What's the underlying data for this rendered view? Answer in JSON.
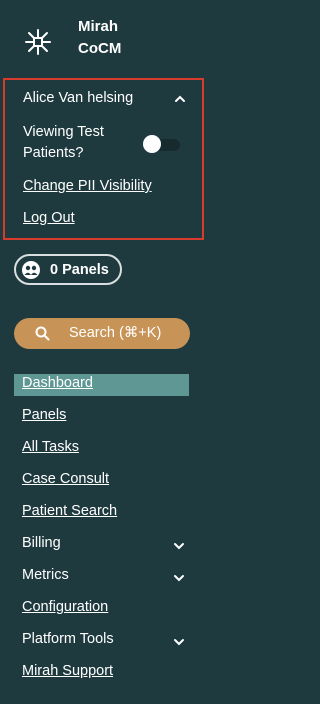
{
  "brand": {
    "line1": "Mirah",
    "line2": "CoCM"
  },
  "user_menu": {
    "name": "Alice Van helsing",
    "viewing_label": "Viewing Test Patients?",
    "toggle_on": false,
    "change_pii_label": "Change PII Visibility",
    "logout_label": "Log Out"
  },
  "panels": {
    "label": "0 Panels"
  },
  "search": {
    "label": "Search  (⌘+K)"
  },
  "nav": {
    "items": [
      {
        "label": "Dashboard",
        "active": true,
        "expandable": false
      },
      {
        "label": "Panels",
        "active": false,
        "expandable": false
      },
      {
        "label": "All Tasks",
        "active": false,
        "expandable": false
      },
      {
        "label": "Case Consult",
        "active": false,
        "expandable": false
      },
      {
        "label": "Patient Search",
        "active": false,
        "expandable": false
      },
      {
        "label": "Billing",
        "active": false,
        "expandable": true
      },
      {
        "label": "Metrics",
        "active": false,
        "expandable": true
      },
      {
        "label": "Configuration",
        "active": false,
        "expandable": false
      },
      {
        "label": "Platform Tools",
        "active": false,
        "expandable": true
      },
      {
        "label": "Mirah Support",
        "active": false,
        "expandable": false
      }
    ]
  },
  "colors": {
    "background": "#1f3a3f",
    "accent_search": "#c89356",
    "active_nav": "#5f9794",
    "highlight_border": "#d83a2e"
  }
}
